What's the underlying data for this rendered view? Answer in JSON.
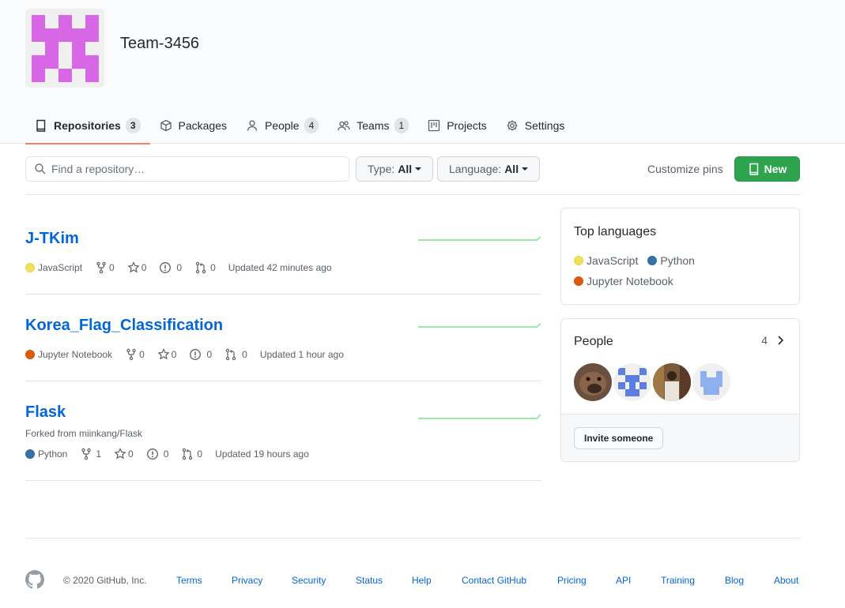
{
  "org": {
    "name": "Team-3456",
    "avatar_icon": "identicon-org",
    "avatar_color": "#d867e6"
  },
  "tabs": [
    {
      "label": "Repositories",
      "count": "3",
      "icon": "repo-icon",
      "selected": true
    },
    {
      "label": "Packages",
      "icon": "package-icon"
    },
    {
      "label": "People",
      "count": "4",
      "icon": "person-icon"
    },
    {
      "label": "Teams",
      "count": "1",
      "icon": "people-icon"
    },
    {
      "label": "Projects",
      "icon": "project-icon"
    },
    {
      "label": "Settings",
      "icon": "gear-icon"
    }
  ],
  "toolbar": {
    "search_placeholder": "Find a repository…",
    "type_label": "Type:",
    "type_value": "All",
    "language_label": "Language:",
    "language_value": "All",
    "customize_label": "Customize pins",
    "new_label": "New"
  },
  "repos": [
    {
      "name": "J-TKim",
      "language": "JavaScript",
      "lang_color": "#f1e05a",
      "forks": "0",
      "stars": "0",
      "issues": "0",
      "prs": "0",
      "updated": "Updated 42 minutes ago"
    },
    {
      "name": "Korea_Flag_Classification",
      "language": "Jupyter Notebook",
      "lang_color": "#DA5B0B",
      "forks": "0",
      "stars": "0",
      "issues": "0",
      "prs": "0",
      "updated": "Updated 1 hour ago"
    },
    {
      "name": "Flask",
      "forked_from": "Forked from miinkang/Flask",
      "language": "Python",
      "lang_color": "#3572A5",
      "forks": "1",
      "stars": "0",
      "issues": "0",
      "prs": "0",
      "updated": "Updated 19 hours ago"
    }
  ],
  "sidebar": {
    "top_languages_title": "Top languages",
    "languages": [
      {
        "name": "JavaScript",
        "color": "#f1e05a"
      },
      {
        "name": "Python",
        "color": "#3572A5"
      },
      {
        "name": "Jupyter Notebook",
        "color": "#DA5B0B"
      }
    ],
    "people_title": "People",
    "people_count": "4",
    "invite_label": "Invite someone"
  },
  "footer": {
    "copyright": "© 2020 GitHub, Inc.",
    "links": [
      "Terms",
      "Privacy",
      "Security",
      "Status",
      "Help",
      "Contact GitHub",
      "Pricing",
      "API",
      "Training",
      "Blog",
      "About"
    ]
  },
  "colors": {
    "accent_underline": "#f9826c",
    "link": "#0366d6",
    "new_button": "#2ea44f",
    "sparkline": "#40c463"
  }
}
